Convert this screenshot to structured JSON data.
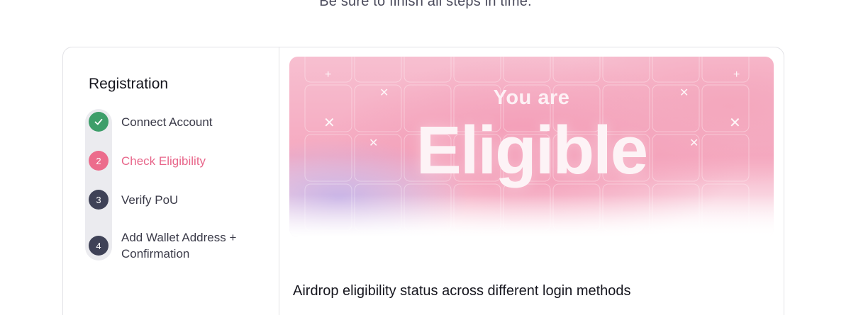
{
  "page": {
    "subtitle": "Be sure to finish all steps in time."
  },
  "registration": {
    "title": "Registration",
    "steps": [
      {
        "number": "",
        "label": "Connect Account",
        "status": "completed",
        "icon": "check-icon"
      },
      {
        "number": "2",
        "label": "Check Eligibility",
        "status": "active"
      },
      {
        "number": "3",
        "label": "Verify PoU",
        "status": "pending"
      },
      {
        "number": "4",
        "label_line1": "Add Wallet Address +",
        "label_line2": "Confirmation",
        "status": "pending"
      }
    ]
  },
  "hero": {
    "small_text": "You are",
    "big_text": "Eligible"
  },
  "content": {
    "heading": "Airdrop eligibility status across different login methods"
  },
  "colors": {
    "completed": "#3e9e6a",
    "active": "#ec6c8c",
    "pending": "#3f4257",
    "hero_pink": "#f5a9c0"
  }
}
